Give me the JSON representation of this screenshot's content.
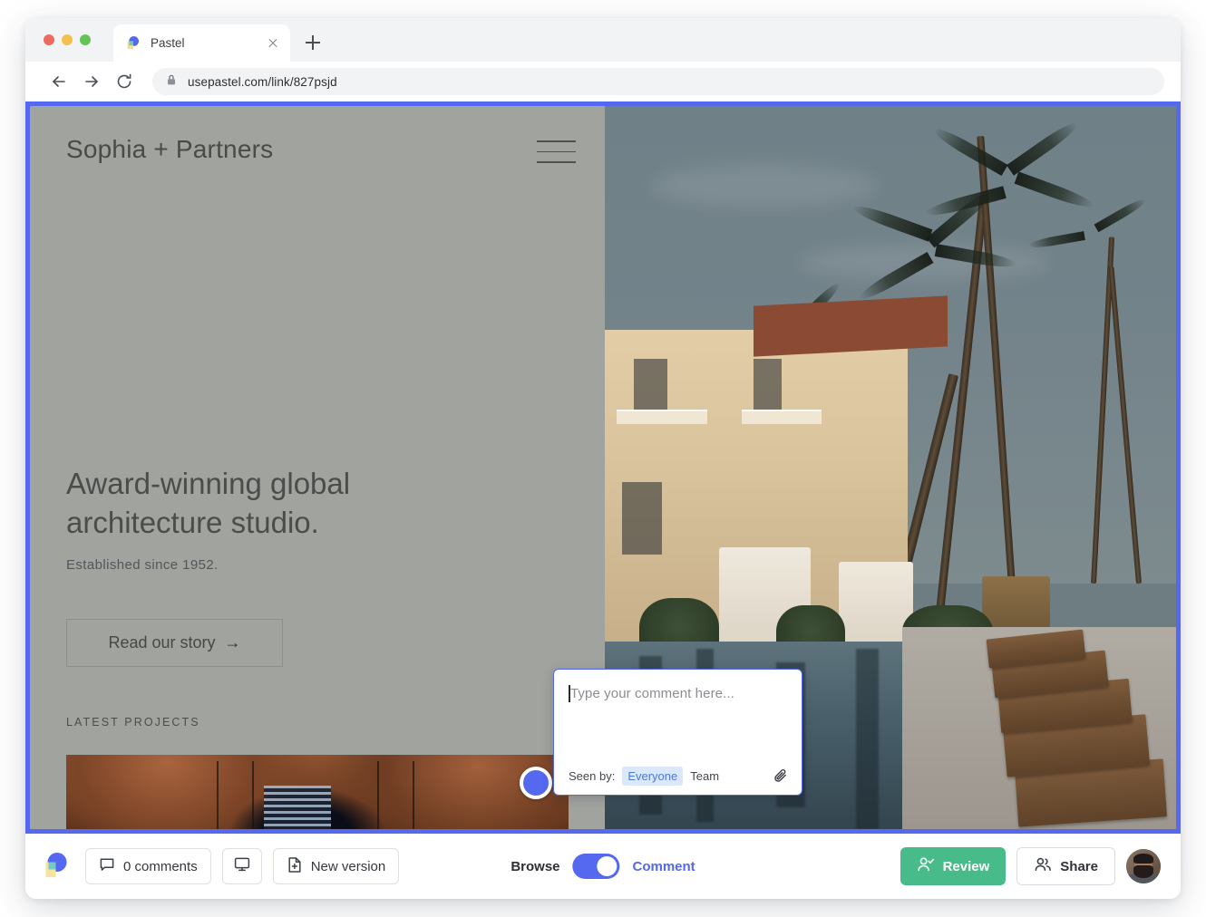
{
  "browser": {
    "tab": {
      "title": "Pastel",
      "favicon": "pastel-logo-icon",
      "close_icon": "close-icon"
    },
    "new_tab_icon": "plus-icon",
    "nav": {
      "back_icon": "arrow-left-icon",
      "forward_icon": "arrow-right-icon",
      "reload_icon": "reload-icon",
      "lock_icon": "lock-icon"
    },
    "url": "usepastel.com/link/827psjd",
    "traffic_lights": [
      "close",
      "minimize",
      "maximize"
    ]
  },
  "site": {
    "logo": "Sophia + Partners",
    "menu_icon": "hamburger-menu-icon",
    "hero_heading": "Award-winning global architecture studio.",
    "hero_subtitle": "Established since 1952.",
    "cta_label": "Read our story",
    "cta_arrow": "→",
    "section_label": "LATEST PROJECTS"
  },
  "comment_popup": {
    "placeholder": "Type your comment here...",
    "seen_by_label": "Seen by:",
    "audience_selected": "Everyone",
    "audience_other": "Team",
    "attach_icon": "paperclip-icon",
    "marker_icon": "comment-marker-pin"
  },
  "toolbar": {
    "app_logo": "pastel-logo-icon",
    "comments_label": "0 comments",
    "comments_icon": "chat-bubble-icon",
    "device_icon": "desktop-monitor-icon",
    "new_version_label": "New version",
    "new_version_icon": "file-plus-icon",
    "mode_left_label": "Browse",
    "mode_right_label": "Comment",
    "mode_toggle_state": "on",
    "review_label": "Review",
    "review_icon": "user-check-icon",
    "share_label": "Share",
    "share_icon": "users-icon",
    "avatar": "user-avatar-photo"
  },
  "colors": {
    "accent_blue": "#5468f0",
    "review_green": "#47bb8a",
    "site_bg_gray": "#a1a39f",
    "pill_blue_bg": "#dbe7fb",
    "pill_blue_text": "#4b7bd6"
  }
}
